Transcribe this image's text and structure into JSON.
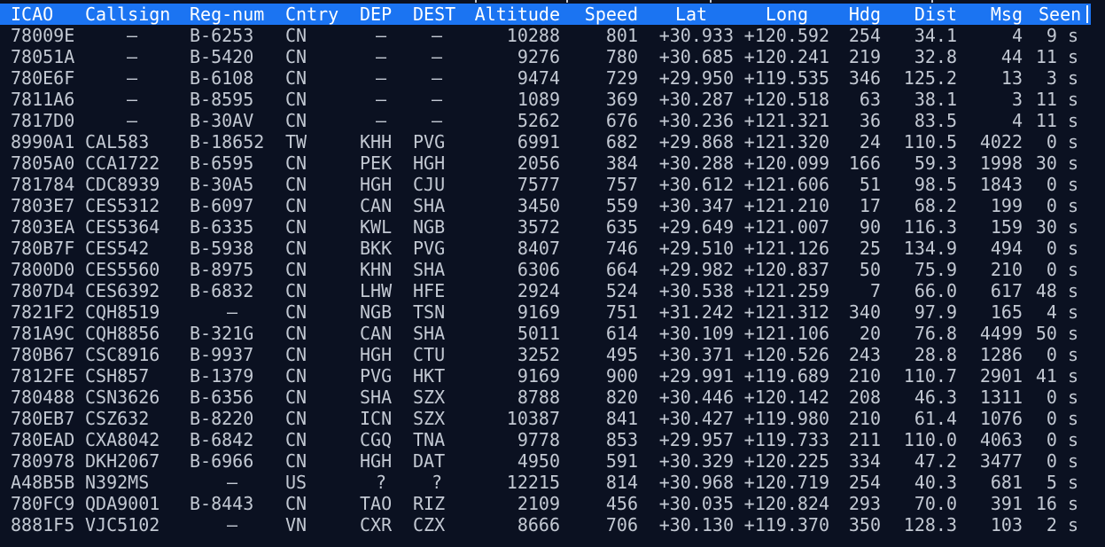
{
  "columns": [
    "ICAO",
    "Callsign",
    "Reg-num",
    "Cntry",
    "DEP",
    "DEST",
    "Altitude",
    "Speed",
    "Lat",
    "Long",
    "Hdg",
    "Dist",
    "Msg",
    "Seen"
  ],
  "rows": [
    [
      "78009E",
      "–",
      "B-6253",
      "CN",
      "–",
      "–",
      "10288",
      "801",
      "+30.933",
      "+120.592",
      "254",
      "34.1",
      "4",
      "9 s"
    ],
    [
      "78051A",
      "–",
      "B-5420",
      "CN",
      "–",
      "–",
      "9276",
      "780",
      "+30.685",
      "+120.241",
      "219",
      "32.8",
      "44",
      "11 s"
    ],
    [
      "780E6F",
      "–",
      "B-6108",
      "CN",
      "–",
      "–",
      "9474",
      "729",
      "+29.950",
      "+119.535",
      "346",
      "125.2",
      "13",
      "3 s"
    ],
    [
      "7811A6",
      "–",
      "B-8595",
      "CN",
      "–",
      "–",
      "1089",
      "369",
      "+30.287",
      "+120.518",
      "63",
      "38.1",
      "3",
      "11 s"
    ],
    [
      "7817D0",
      "–",
      "B-30AV",
      "CN",
      "–",
      "–",
      "5262",
      "676",
      "+30.236",
      "+121.321",
      "36",
      "83.5",
      "4",
      "11 s"
    ],
    [
      "8990A1",
      "CAL583",
      "B-18652",
      "TW",
      "KHH",
      "PVG",
      "6991",
      "682",
      "+29.868",
      "+121.320",
      "24",
      "110.5",
      "4022",
      "0 s"
    ],
    [
      "7805A0",
      "CCA1722",
      "B-6595",
      "CN",
      "PEK",
      "HGH",
      "2056",
      "384",
      "+30.288",
      "+120.099",
      "166",
      "59.3",
      "1998",
      "30 s"
    ],
    [
      "781784",
      "CDC8939",
      "B-30A5",
      "CN",
      "HGH",
      "CJU",
      "7577",
      "757",
      "+30.612",
      "+121.606",
      "51",
      "98.5",
      "1843",
      "0 s"
    ],
    [
      "7803E7",
      "CES5312",
      "B-6097",
      "CN",
      "CAN",
      "SHA",
      "3450",
      "559",
      "+30.347",
      "+121.210",
      "17",
      "68.2",
      "199",
      "0 s"
    ],
    [
      "7803EA",
      "CES5364",
      "B-6335",
      "CN",
      "KWL",
      "NGB",
      "3572",
      "635",
      "+29.649",
      "+121.007",
      "90",
      "116.3",
      "159",
      "30 s"
    ],
    [
      "780B7F",
      "CES542",
      "B-5938",
      "CN",
      "BKK",
      "PVG",
      "8407",
      "746",
      "+29.510",
      "+121.126",
      "25",
      "134.9",
      "494",
      "0 s"
    ],
    [
      "7800D0",
      "CES5560",
      "B-8975",
      "CN",
      "KHN",
      "SHA",
      "6306",
      "664",
      "+29.982",
      "+120.837",
      "50",
      "75.9",
      "210",
      "0 s"
    ],
    [
      "7807D4",
      "CES6392",
      "B-6832",
      "CN",
      "LHW",
      "HFE",
      "2924",
      "524",
      "+30.538",
      "+121.259",
      "7",
      "66.0",
      "617",
      "48 s"
    ],
    [
      "7821F2",
      "CQH8519",
      "–",
      "CN",
      "NGB",
      "TSN",
      "9169",
      "751",
      "+31.242",
      "+121.312",
      "340",
      "97.9",
      "165",
      "4 s"
    ],
    [
      "781A9C",
      "CQH8856",
      "B-321G",
      "CN",
      "CAN",
      "SHA",
      "5011",
      "614",
      "+30.109",
      "+121.106",
      "20",
      "76.8",
      "4499",
      "50 s"
    ],
    [
      "780B67",
      "CSC8916",
      "B-9937",
      "CN",
      "HGH",
      "CTU",
      "3252",
      "495",
      "+30.371",
      "+120.526",
      "243",
      "28.8",
      "1286",
      "0 s"
    ],
    [
      "7812FE",
      "CSH857",
      "B-1379",
      "CN",
      "PVG",
      "HKT",
      "9169",
      "900",
      "+29.991",
      "+119.689",
      "210",
      "110.7",
      "2901",
      "41 s"
    ],
    [
      "780488",
      "CSN3626",
      "B-6356",
      "CN",
      "SHA",
      "SZX",
      "8788",
      "820",
      "+30.446",
      "+120.142",
      "208",
      "46.3",
      "1311",
      "0 s"
    ],
    [
      "780EB7",
      "CSZ632",
      "B-8220",
      "CN",
      "ICN",
      "SZX",
      "10387",
      "841",
      "+30.427",
      "+119.980",
      "210",
      "61.4",
      "1076",
      "0 s"
    ],
    [
      "780EAD",
      "CXA8042",
      "B-6842",
      "CN",
      "CGQ",
      "TNA",
      "9778",
      "853",
      "+29.957",
      "+119.733",
      "211",
      "110.0",
      "4063",
      "0 s"
    ],
    [
      "780978",
      "DKH2067",
      "B-6966",
      "CN",
      "HGH",
      "DAT",
      "4950",
      "591",
      "+30.329",
      "+120.225",
      "334",
      "47.2",
      "3477",
      "0 s"
    ],
    [
      "A48B5B",
      "N392MS",
      "–",
      "US",
      "?",
      "?",
      "12215",
      "814",
      "+30.968",
      "+120.719",
      "254",
      "40.3",
      "681",
      "5 s"
    ],
    [
      "780FC9",
      "QDA9001",
      "B-8443",
      "CN",
      "TAO",
      "RIZ",
      "2109",
      "456",
      "+30.035",
      "+120.824",
      "293",
      "70.0",
      "391",
      "16 s"
    ],
    [
      "8881F5",
      "VJC5102",
      "–",
      "VN",
      "CXR",
      "CZX",
      "8666",
      "706",
      "+30.130",
      "+119.370",
      "350",
      "128.3",
      "103",
      "2 s"
    ]
  ],
  "colors": {
    "background": "#0b1121",
    "header_bg": "#1b74f2",
    "header_text": "#ffffff",
    "text": "#c3c9d3"
  }
}
